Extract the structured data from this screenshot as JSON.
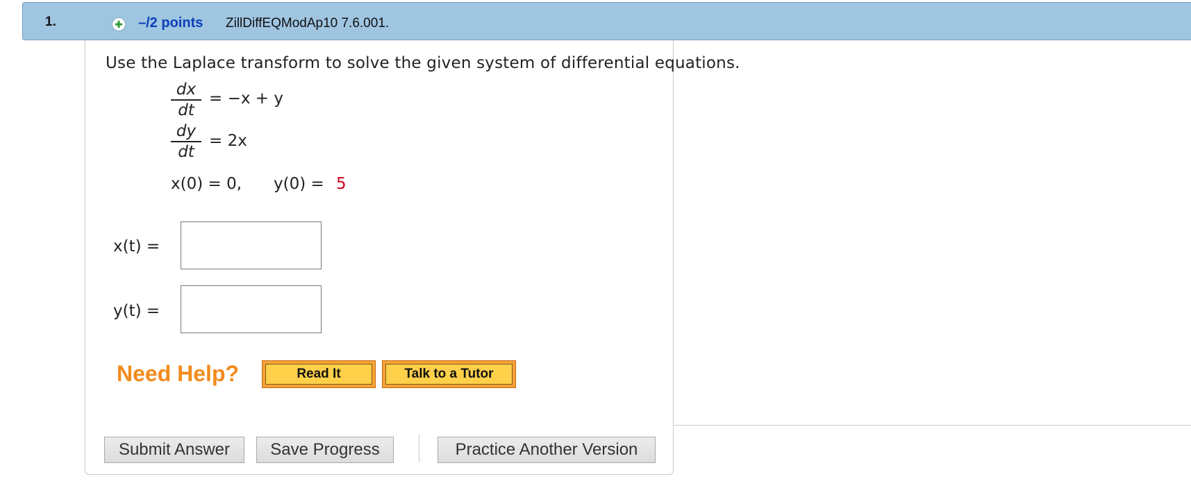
{
  "question": {
    "number": "1.",
    "points": "–/2 points",
    "code": "ZillDiffEQModAp10 7.6.001."
  },
  "instruction": "Use the Laplace transform to solve the given system of differential equations.",
  "equations": {
    "eq1": {
      "num": "dx",
      "den": "dt",
      "rhs": "= −x + y"
    },
    "eq2": {
      "num": "dy",
      "den": "dt",
      "rhs": "= 2x"
    },
    "initial": {
      "x_part": "x(0) = 0,",
      "y_part": "y(0) =",
      "y_value": "5"
    }
  },
  "answers": {
    "x_label": "x(t)  =",
    "x_value": "",
    "y_label": "y(t)  =",
    "y_value": ""
  },
  "help": {
    "title": "Need Help?",
    "read_it": "Read It",
    "tutor": "Talk to a Tutor"
  },
  "actions": {
    "submit": "Submit Answer",
    "save": "Save Progress",
    "practice": "Practice Another Version"
  },
  "colors": {
    "header_bg": "#9fc5e1",
    "points": "#0b3fb7",
    "need_help": "#f28a1c",
    "given_value": "#d0021b"
  },
  "icons": {
    "expand": "plus-circle-icon"
  }
}
